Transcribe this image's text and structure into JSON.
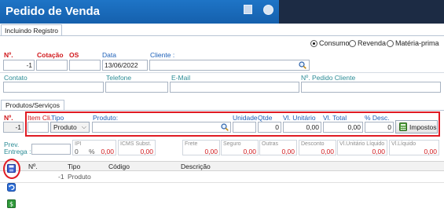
{
  "window": {
    "title": "Pedido de Venda"
  },
  "tabs": {
    "main": "Incluindo Registro",
    "inner": "Produtos/Serviços"
  },
  "radios": [
    {
      "label": "Consumo",
      "selected": true
    },
    {
      "label": "Revenda",
      "selected": false
    },
    {
      "label": "Matéria-prima",
      "selected": false
    }
  ],
  "header": {
    "numero_label": "Nº.",
    "numero_value": "-1",
    "cotacao_label": "Cotação",
    "os_label": "OS",
    "data_label": "Data",
    "data_value": "13/06/2022",
    "cliente_label": "Cliente :"
  },
  "contact": {
    "contato_label": "Contato",
    "telefone_label": "Telefone",
    "email_label": "E-Mail",
    "pedido_label": "Nº. Pedido Cliente"
  },
  "item": {
    "numero_label": "Nº.",
    "numero_value": "-1",
    "itemcli_label": "Item Cli.",
    "tipo_label": "Tipo",
    "tipo_value": "Produto",
    "produto_label": "Produto:",
    "unidade_label": "Unidade",
    "qtde_label": "Qtde",
    "qtde_value": "0",
    "vlunit_label": "Vl. Unitário",
    "vlunit_value": "0,00",
    "vltotal_label": "Vl. Total",
    "vltotal_value": "0,00",
    "desc_label": "% Desc.",
    "desc_value": "0",
    "impostos_label": "Impostos"
  },
  "totals": {
    "prev_label_1": "Prev.",
    "prev_label_2": "Entrega :",
    "ipi_label": "IPI",
    "ipi_value": "0",
    "ipi_pct": "%",
    "ipi_amount": "0,00",
    "icms_label": "ICMS Subst.",
    "icms_value": "0,00",
    "frete_label": "Frete",
    "frete_value": "0,00",
    "seguro_label": "Seguro",
    "seguro_value": "0,00",
    "outras_label": "Outras",
    "outras_value": "0,00",
    "desconto_label": "Desconto",
    "desconto_value": "0,00",
    "vlunitliq_label": "Vl.Unitário Líquido",
    "vlunitliq_value": "0,00",
    "vlliq_label": "Vl.Líquido",
    "vlliq_value": "0,00"
  },
  "grid": {
    "columns": [
      "Nº.",
      "Tipo",
      "Código",
      "Descrição"
    ],
    "rows": [
      {
        "numero": "-1",
        "tipo": "Produto",
        "codigo": "",
        "descricao": ""
      }
    ]
  },
  "colors": {
    "title_bar": "#1868b8",
    "accent_red": "#e01b24",
    "label_red": "#d0181c",
    "label_blue": "#1b5fb8",
    "label_teal": "#2c8c96"
  },
  "icons": [
    "save-icon",
    "undo-icon",
    "money-icon",
    "search-icon",
    "calculator-icon"
  ]
}
